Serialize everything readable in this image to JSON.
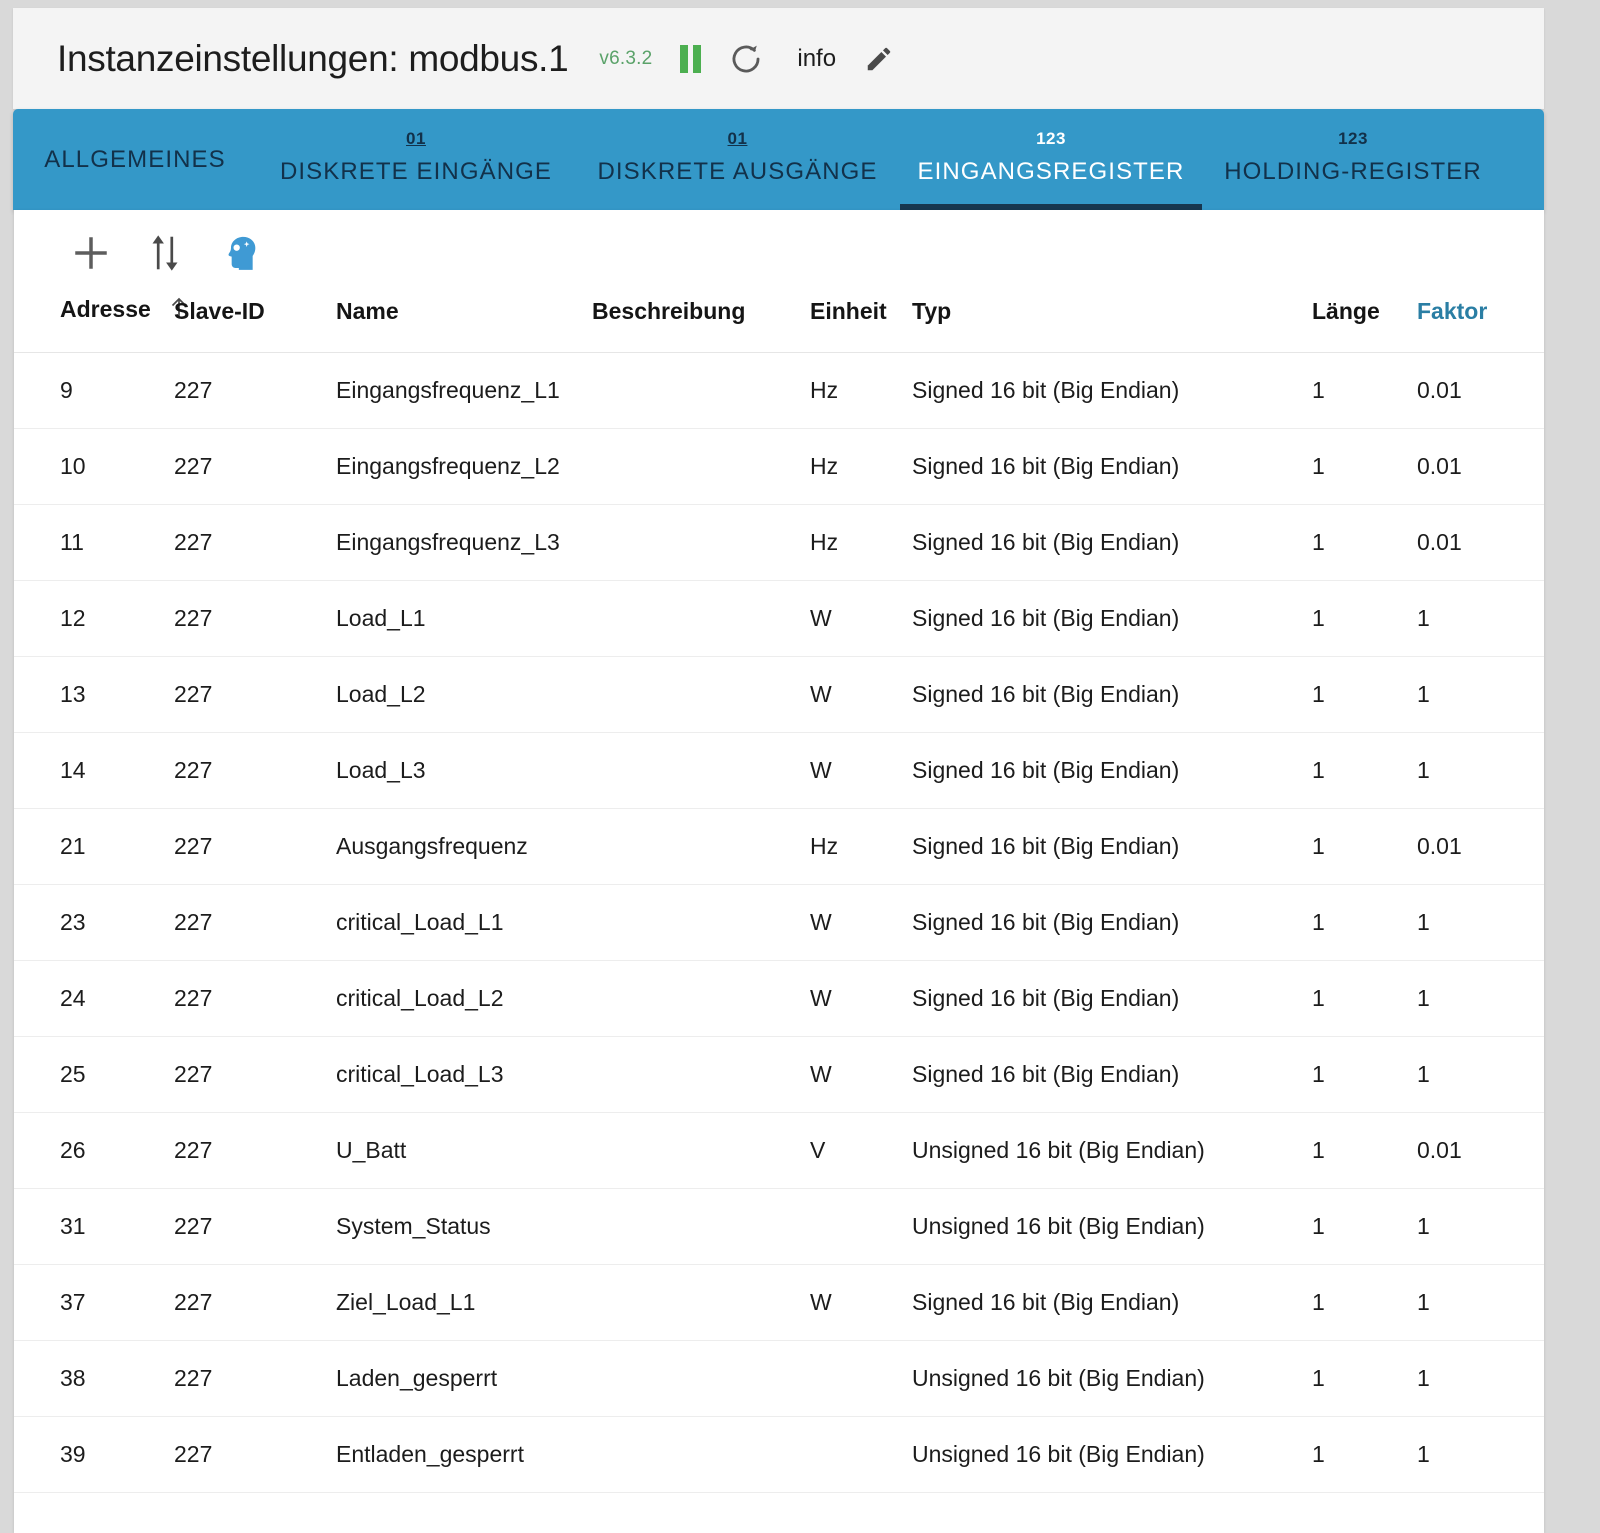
{
  "header": {
    "title": "Instanzeinstellungen: modbus.1",
    "version": "v6.3.2",
    "info_label": "info",
    "icons": {
      "pause": "pause-icon",
      "refresh": "refresh-icon",
      "edit": "edit-pencil-icon"
    },
    "colors": {
      "version_green": "#5aa269",
      "pause_green": "#4caf50"
    }
  },
  "tabs": [
    {
      "glyph": "",
      "label": "ALLGEMEINES",
      "active": false
    },
    {
      "glyph": "01",
      "label": "DISKRETE EINGÄNGE",
      "active": false
    },
    {
      "glyph": "01",
      "label": "DISKRETE AUSGÄNGE",
      "active": false
    },
    {
      "glyph": "123",
      "label": "EINGANGSREGISTER",
      "active": true
    },
    {
      "glyph": "123",
      "label": "HOLDING-REGISTER",
      "active": false
    }
  ],
  "toolbar": {
    "buttons": [
      {
        "name": "add-button",
        "icon": "plus-icon"
      },
      {
        "name": "import-export-button",
        "icon": "up-down-arrows-icon"
      },
      {
        "name": "ai-assistant-button",
        "icon": "head-sparkle-icon"
      }
    ]
  },
  "table": {
    "columns": [
      {
        "key": "adresse",
        "label": "Adresse",
        "sorted": "asc",
        "accent": false
      },
      {
        "key": "slave_id",
        "label": "Slave-ID",
        "sorted": null,
        "accent": false
      },
      {
        "key": "name",
        "label": "Name",
        "sorted": null,
        "accent": false
      },
      {
        "key": "beschreibung",
        "label": "Beschreibung",
        "sorted": null,
        "accent": false
      },
      {
        "key": "einheit",
        "label": "Einheit",
        "sorted": null,
        "accent": false
      },
      {
        "key": "typ",
        "label": "Typ",
        "sorted": null,
        "accent": false
      },
      {
        "key": "laenge",
        "label": "Länge",
        "sorted": null,
        "accent": false
      },
      {
        "key": "faktor",
        "label": "Faktor",
        "sorted": null,
        "accent": true
      }
    ],
    "rows": [
      {
        "adresse": "9",
        "slave_id": "227",
        "name": "Eingangsfrequenz_L1",
        "beschreibung": "",
        "einheit": "Hz",
        "typ": "Signed 16 bit (Big Endian)",
        "laenge": "1",
        "faktor": "0.01"
      },
      {
        "adresse": "10",
        "slave_id": "227",
        "name": "Eingangsfrequenz_L2",
        "beschreibung": "",
        "einheit": "Hz",
        "typ": "Signed 16 bit (Big Endian)",
        "laenge": "1",
        "faktor": "0.01"
      },
      {
        "adresse": "11",
        "slave_id": "227",
        "name": "Eingangsfrequenz_L3",
        "beschreibung": "",
        "einheit": "Hz",
        "typ": "Signed 16 bit (Big Endian)",
        "laenge": "1",
        "faktor": "0.01"
      },
      {
        "adresse": "12",
        "slave_id": "227",
        "name": "Load_L1",
        "beschreibung": "",
        "einheit": "W",
        "typ": "Signed 16 bit (Big Endian)",
        "laenge": "1",
        "faktor": "1"
      },
      {
        "adresse": "13",
        "slave_id": "227",
        "name": "Load_L2",
        "beschreibung": "",
        "einheit": "W",
        "typ": "Signed 16 bit (Big Endian)",
        "laenge": "1",
        "faktor": "1"
      },
      {
        "adresse": "14",
        "slave_id": "227",
        "name": "Load_L3",
        "beschreibung": "",
        "einheit": "W",
        "typ": "Signed 16 bit (Big Endian)",
        "laenge": "1",
        "faktor": "1"
      },
      {
        "adresse": "21",
        "slave_id": "227",
        "name": "Ausgangsfrequenz",
        "beschreibung": "",
        "einheit": "Hz",
        "typ": "Signed 16 bit (Big Endian)",
        "laenge": "1",
        "faktor": "0.01"
      },
      {
        "adresse": "23",
        "slave_id": "227",
        "name": "critical_Load_L1",
        "beschreibung": "",
        "einheit": "W",
        "typ": "Signed 16 bit (Big Endian)",
        "laenge": "1",
        "faktor": "1"
      },
      {
        "adresse": "24",
        "slave_id": "227",
        "name": "critical_Load_L2",
        "beschreibung": "",
        "einheit": "W",
        "typ": "Signed 16 bit (Big Endian)",
        "laenge": "1",
        "faktor": "1"
      },
      {
        "adresse": "25",
        "slave_id": "227",
        "name": "critical_Load_L3",
        "beschreibung": "",
        "einheit": "W",
        "typ": "Signed 16 bit (Big Endian)",
        "laenge": "1",
        "faktor": "1"
      },
      {
        "adresse": "26",
        "slave_id": "227",
        "name": "U_Batt",
        "beschreibung": "",
        "einheit": "V",
        "typ": "Unsigned 16 bit (Big Endian)",
        "laenge": "1",
        "faktor": "0.01"
      },
      {
        "adresse": "31",
        "slave_id": "227",
        "name": "System_Status",
        "beschreibung": "",
        "einheit": "",
        "typ": "Unsigned 16 bit (Big Endian)",
        "laenge": "1",
        "faktor": "1"
      },
      {
        "adresse": "37",
        "slave_id": "227",
        "name": "Ziel_Load_L1",
        "beschreibung": "",
        "einheit": "W",
        "typ": "Signed 16 bit (Big Endian)",
        "laenge": "1",
        "faktor": "1"
      },
      {
        "adresse": "38",
        "slave_id": "227",
        "name": "Laden_gesperrt",
        "beschreibung": "",
        "einheit": "",
        "typ": "Unsigned 16 bit (Big Endian)",
        "laenge": "1",
        "faktor": "1"
      },
      {
        "adresse": "39",
        "slave_id": "227",
        "name": "Entladen_gesperrt",
        "beschreibung": "",
        "einheit": "",
        "typ": "Unsigned 16 bit (Big Endian)",
        "laenge": "1",
        "faktor": "1"
      }
    ]
  },
  "colors": {
    "tabbar_blue": "#3498c8",
    "tab_active_underline": "#17374f",
    "accent_teal": "#2a7ea4",
    "page_background": "#d9d9d9"
  }
}
